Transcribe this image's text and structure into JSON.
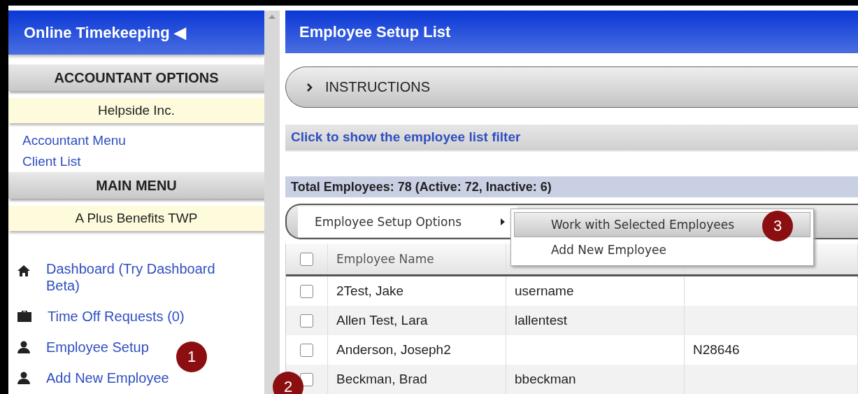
{
  "sidebar": {
    "title": "Online Timekeeping ◀",
    "sections": [
      {
        "heading": "ACCOUNTANT OPTIONS",
        "company": "Helpside Inc.",
        "links": [
          "Accountant Menu",
          "Client List"
        ]
      },
      {
        "heading": "MAIN MENU",
        "company": "A Plus Benefits TWP"
      }
    ],
    "nav": [
      {
        "label": "Dashboard (Try Dashboard Beta)",
        "kind": "home"
      },
      {
        "label": "Time Off Requests (0)",
        "kind": "briefcase"
      },
      {
        "label": "Employee Setup",
        "kind": "person"
      },
      {
        "label": "Add New Employee",
        "kind": "person"
      }
    ]
  },
  "main": {
    "title": "Employee Setup List",
    "instructions": "INSTRUCTIONS",
    "filter_link": "Click to show the employee list filter",
    "total": "Total Employees: 78 (Active: 72, Inactive: 6)",
    "options_menu": {
      "label": "Employee Setup Options",
      "submenu": [
        {
          "label": "Work with Selected Employees",
          "selected": true
        },
        {
          "label": "Add New Employee",
          "selected": false
        }
      ]
    },
    "table": {
      "select_all_checked": false,
      "columns": [
        "Employee Name"
      ],
      "rows": [
        {
          "checked": false,
          "name": "2Test, Jake",
          "column_3": "username"
        },
        {
          "checked": false,
          "name": "Allen Test, Lara",
          "column_3": "lallentest"
        },
        {
          "checked": false,
          "name": "Anderson, Joseph2",
          "column_4": "N28646"
        },
        {
          "checked": false,
          "name": "Beckman, Brad",
          "column_3": "bbeckman"
        }
      ]
    }
  },
  "callouts": [
    "1",
    "2",
    "3"
  ]
}
